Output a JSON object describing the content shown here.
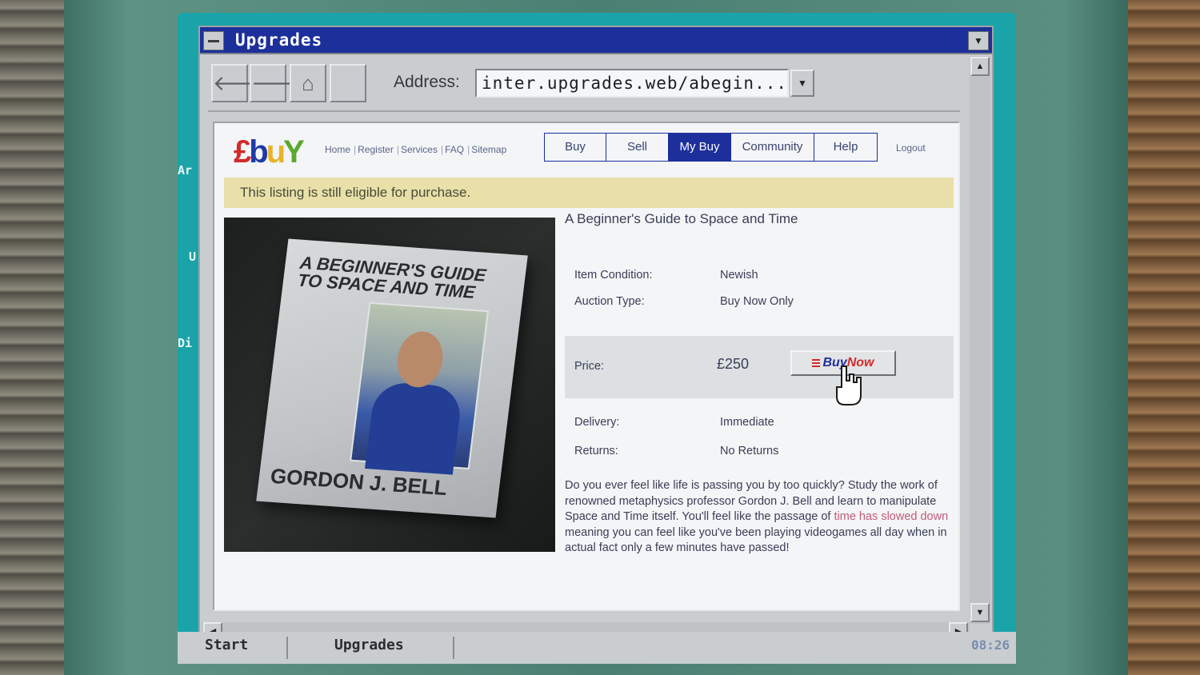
{
  "window": {
    "title": "Upgrades"
  },
  "toolbar": {
    "back_icon": "left-arrow-icon",
    "forward_icon": "right-arrow-icon",
    "home_icon": "home-icon",
    "address_label": "Address:",
    "address_value": "inter.upgrades.web/abegin..."
  },
  "desktop": {
    "labels": [
      "Ar",
      "U",
      "Di"
    ]
  },
  "site": {
    "logo": {
      "l1": "£",
      "l2": "b",
      "l3": "u",
      "l4": "Y"
    },
    "top_links": [
      "Home",
      "Register",
      "Services",
      "FAQ",
      "Sitemap"
    ],
    "tabs": [
      {
        "label": "Buy",
        "active": false
      },
      {
        "label": "Sell",
        "active": false
      },
      {
        "label": "My Buy",
        "active": true
      },
      {
        "label": "Community",
        "active": false
      },
      {
        "label": "Help",
        "active": false
      }
    ],
    "logout": "Logout",
    "banner": "This listing is still eligible for purchase."
  },
  "listing": {
    "title": "A Beginner's Guide to Space and Time",
    "book_cover": {
      "title": "A BEGINNER'S GUIDE TO SPACE AND TIME",
      "author": "GORDON J. BELL"
    },
    "condition_label": "Item Condition:",
    "condition_value": "Newish",
    "auction_label": "Auction Type:",
    "auction_value": "Buy Now Only",
    "price_label": "Price:",
    "price_value": "£250",
    "buy_now": {
      "part1": "Buy",
      "part2": "Now"
    },
    "delivery_label": "Delivery:",
    "delivery_value": "Immediate",
    "returns_label": "Returns:",
    "returns_value": "No Returns",
    "description": {
      "before": "Do you ever feel like life is passing you by too quickly? Study the work of renowned metaphysics professor Gordon J. Bell and learn to manipulate Space and Time itself. You'll feel like the passage of ",
      "highlight": "time has slowed down",
      "after": " meaning you can feel like you've been playing videogames all day when in actual fact only a few minutes have passed!"
    }
  },
  "taskbar": {
    "start": "Start",
    "task": "Upgrades",
    "clock": "08:26"
  },
  "colors": {
    "titlebar": "#1d2f9a",
    "screen": "#1aa3a8",
    "banner": "#e8e0a8",
    "accent_red": "#d42a2a"
  }
}
